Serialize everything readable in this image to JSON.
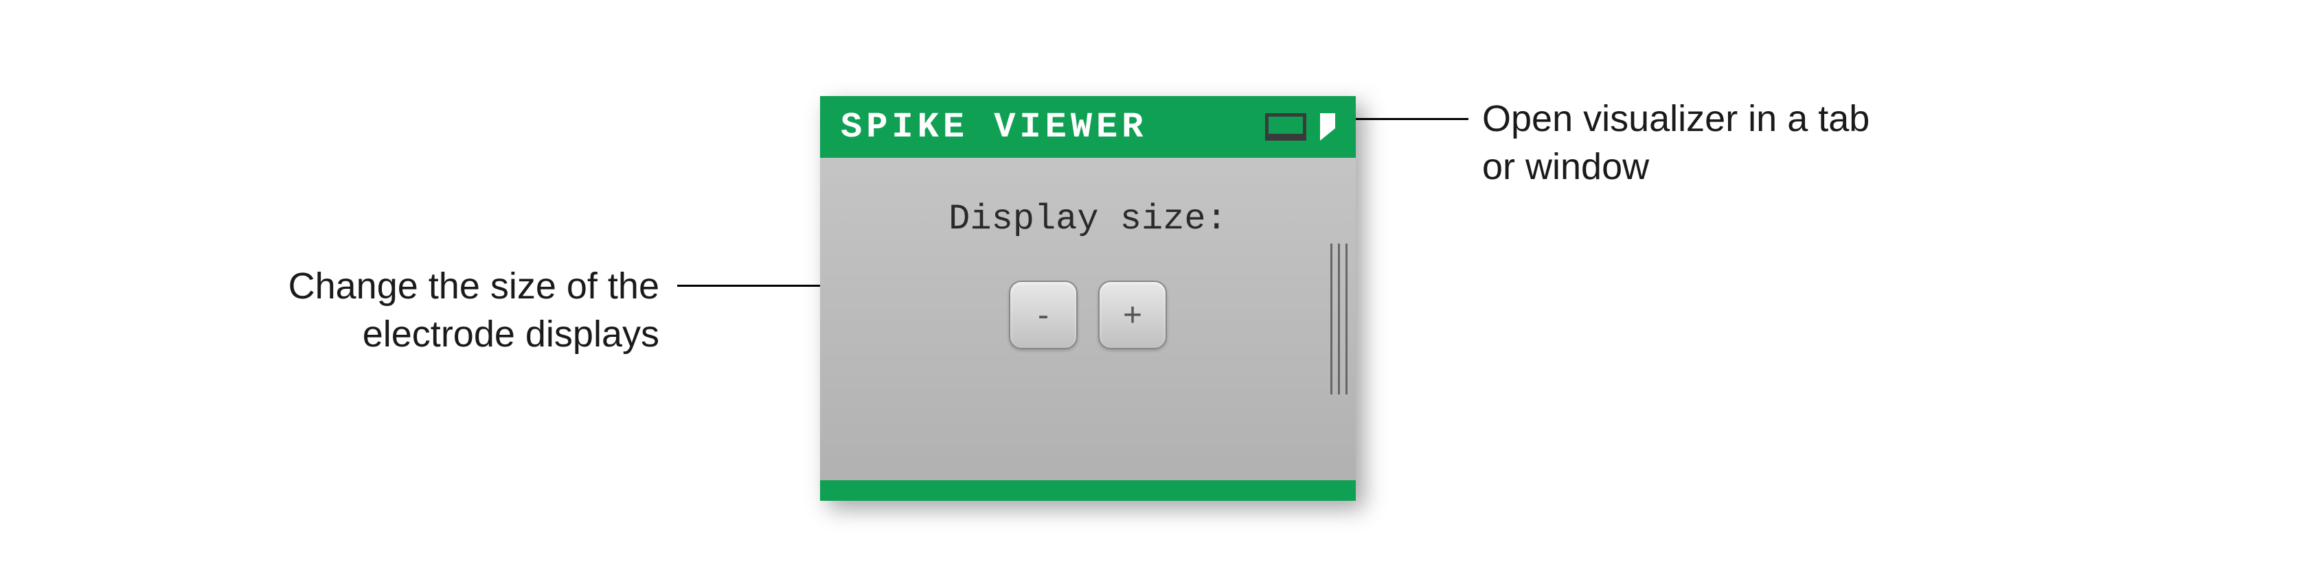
{
  "widget": {
    "title": "SPIKE VIEWER",
    "display_size_label": "Display size:",
    "minus_label": "-",
    "plus_label": "+"
  },
  "annotations": {
    "left": "Change the size of the electrode displays",
    "right": "Open visualizer in a tab or window"
  },
  "colors": {
    "accent": "#0fa054",
    "panel_bg": "#bababa"
  }
}
